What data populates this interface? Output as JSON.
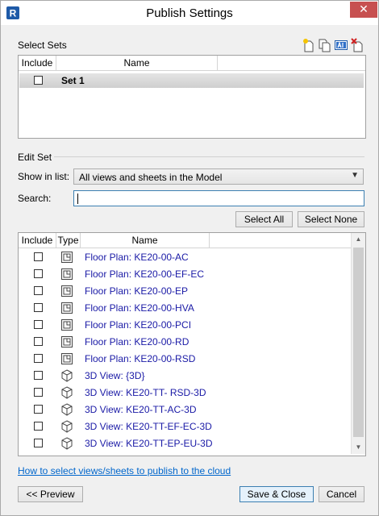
{
  "window": {
    "title": "Publish Settings",
    "app_icon_letter": "R",
    "close_glyph": "✕"
  },
  "select_sets": {
    "label": "Select Sets",
    "columns": {
      "include": "Include",
      "name": "Name"
    },
    "rows": [
      {
        "name": "Set 1",
        "checked": false
      }
    ],
    "toolbar_icons": [
      "new-set-icon",
      "duplicate-set-icon",
      "rename-set-icon",
      "delete-set-icon"
    ]
  },
  "edit_set": {
    "label": "Edit Set",
    "show_in_list_label": "Show in list:",
    "show_in_list_value": "All views and sheets in the Model",
    "search_label": "Search:",
    "search_value": "",
    "select_all": "Select All",
    "select_none": "Select None",
    "columns": {
      "include": "Include",
      "type": "Type",
      "name": "Name"
    },
    "views": [
      {
        "name": "Floor Plan: KE20-00-AC",
        "type": "floor-plan-icon"
      },
      {
        "name": "Floor Plan: KE20-00-EF-EC",
        "type": "floor-plan-icon"
      },
      {
        "name": "Floor Plan: KE20-00-EP",
        "type": "floor-plan-icon"
      },
      {
        "name": "Floor Plan: KE20-00-HVA",
        "type": "floor-plan-icon"
      },
      {
        "name": "Floor Plan: KE20-00-PCI",
        "type": "floor-plan-icon"
      },
      {
        "name": "Floor Plan: KE20-00-RD",
        "type": "floor-plan-icon"
      },
      {
        "name": "Floor Plan: KE20-00-RSD",
        "type": "floor-plan-icon"
      },
      {
        "name": "3D View: {3D}",
        "type": "3d-view-icon"
      },
      {
        "name": "3D View: KE20-TT- RSD-3D",
        "type": "3d-view-icon"
      },
      {
        "name": "3D View: KE20-TT-AC-3D",
        "type": "3d-view-icon"
      },
      {
        "name": "3D View: KE20-TT-EF-EC-3D",
        "type": "3d-view-icon"
      },
      {
        "name": "3D View: KE20-TT-EP-EU-3D",
        "type": "3d-view-icon"
      }
    ]
  },
  "help_link": "How to select views/sheets to publish to the cloud",
  "footer": {
    "preview": "<< Preview",
    "save_close": "Save & Close",
    "cancel": "Cancel"
  },
  "colors": {
    "link": "#0066cc",
    "view_name": "#1a1aa6",
    "close": "#c75050",
    "app_icon": "#1e5aa8"
  }
}
